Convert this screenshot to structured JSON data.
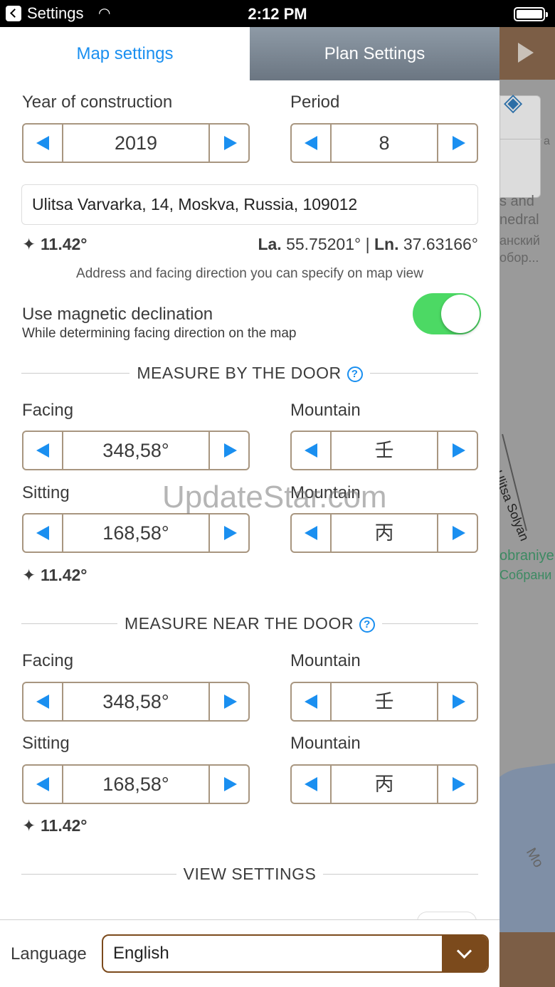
{
  "status_bar": {
    "carrier": "Settings",
    "time": "2:12 PM"
  },
  "tabs": {
    "map_settings": "Map settings",
    "plan_settings": "Plan Settings"
  },
  "construction": {
    "year_label": "Year of construction",
    "year_value": "2019",
    "period_label": "Period",
    "period_value": "8"
  },
  "address": "Ulitsa Varvarka, 14, Moskva, Russia, 109012",
  "declination": "11.42°",
  "coords": {
    "la_label": "La.",
    "la_value": "55.75201°",
    "sep": "|",
    "ln_label": "Ln.",
    "ln_value": "37.63166°"
  },
  "note": "Address and facing direction you can specify on map view",
  "magnetic": {
    "title": "Use magnetic declination",
    "subtitle": "While determining facing direction on the map",
    "enabled": true,
    "toggle_color": "#4cd964"
  },
  "measure_by_door": {
    "title": "MEASURE BY THE DOOR",
    "help": "?",
    "facing_label": "Facing",
    "facing_value": "348,58°",
    "mountain1_label": "Mountain",
    "mountain1_value": "壬",
    "sitting_label": "Sitting",
    "sitting_value": "168,58°",
    "mountain2_label": "Mountain",
    "mountain2_value": "丙",
    "declination": "11.42°"
  },
  "measure_near_door": {
    "title": "MEASURE NEAR THE DOOR",
    "help": "?",
    "facing_label": "Facing",
    "facing_value": "348,58°",
    "mountain1_label": "Mountain",
    "mountain1_value": "壬",
    "sitting_label": "Sitting",
    "sitting_value": "168,58°",
    "mountain2_label": "Mountain",
    "mountain2_value": "丙",
    "declination": "11.42°"
  },
  "view_settings": {
    "title": "VIEW SETTINGS"
  },
  "language": {
    "label": "Language",
    "value": "English"
  },
  "watermark": "UpdateStar.com",
  "map_labels": [
    "s and",
    "nedral",
    "анский",
    "обор...",
    "Ulitsa Solyan",
    "obraniye",
    "Собрани",
    "Mo",
    "a"
  ],
  "colors": {
    "accent": "#1a8ff0",
    "stepper_border": "#a89680",
    "brand_brown": "#7b4a1c"
  }
}
